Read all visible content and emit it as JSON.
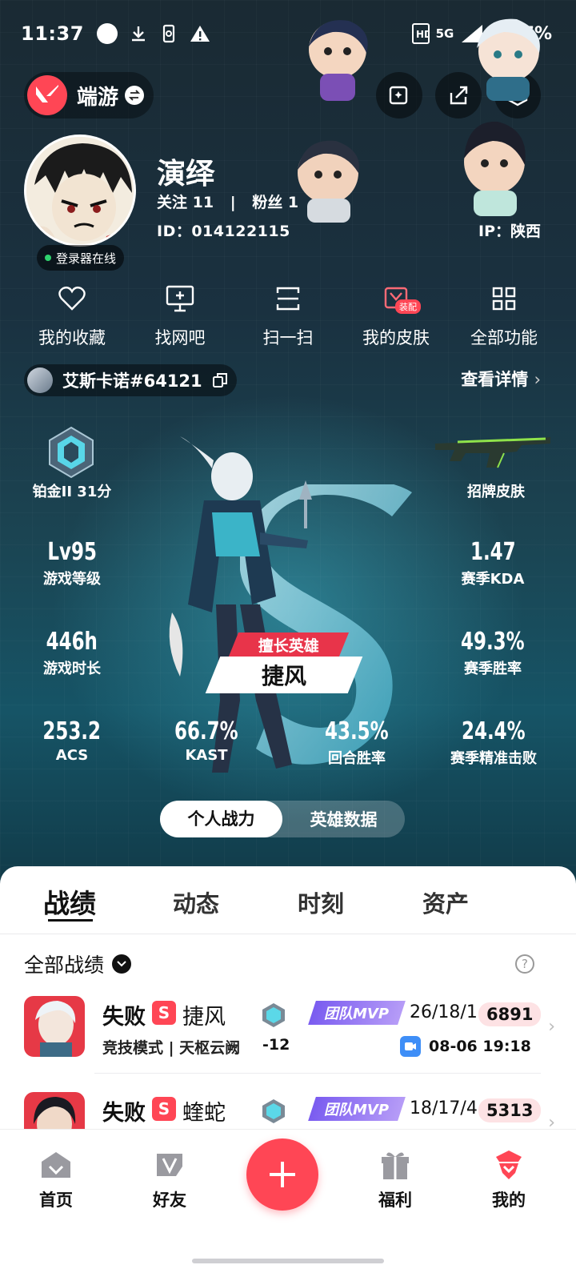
{
  "status": {
    "time": "11:37",
    "network": "5G",
    "battery": "47%"
  },
  "header": {
    "app_name": "端游"
  },
  "profile": {
    "nickname": "演绎",
    "follow_label": "关注 11",
    "fans_label": "粉丝 1",
    "divider": "|",
    "id_label": "ID：014122115",
    "ip_label": "IP：陕西",
    "online": "登录器在线"
  },
  "actions": [
    {
      "label": "我的收藏",
      "icon": "heart-icon"
    },
    {
      "label": "找网吧",
      "icon": "monitor-icon"
    },
    {
      "label": "扫一扫",
      "icon": "scan-icon"
    },
    {
      "label": "我的皮肤",
      "icon": "skin-icon",
      "tag": "装配"
    },
    {
      "label": "全部功能",
      "icon": "grid-icon"
    }
  ],
  "riot": {
    "name": "艾斯卡诺#64121",
    "detail": "查看详情"
  },
  "rank": {
    "label": "铂金II 31分"
  },
  "skin": {
    "label": "招牌皮肤"
  },
  "stats": {
    "level": {
      "v": "Lv95",
      "k": "游戏等级"
    },
    "kda": {
      "v": "1.47",
      "k": "赛季KDA"
    },
    "hours": {
      "v": "446h",
      "k": "游戏时长"
    },
    "winrate": {
      "v": "49.3%",
      "k": "赛季胜率"
    },
    "acs": {
      "v": "253.2",
      "k": "ACS"
    },
    "kast": {
      "v": "66.7%",
      "k": "KAST"
    },
    "round": {
      "v": "43.5%",
      "k": "回合胜率"
    },
    "precise": {
      "v": "24.4%",
      "k": "赛季精准击败"
    }
  },
  "best_agent": {
    "title": "擅长英雄",
    "name": "捷风"
  },
  "toggle": {
    "left": "个人战力",
    "right": "英雄数据"
  },
  "tabs": [
    "战绩",
    "动态",
    "时刻",
    "资产"
  ],
  "filter": {
    "label": "全部战绩",
    "help": "?"
  },
  "matches": [
    {
      "result": "失败",
      "s": "S",
      "agent": "捷风",
      "mode": "竞技模式 | 天枢云阙",
      "delta": "-12",
      "mvp": "团队MVP",
      "kda": "26/18/1",
      "score": "6891",
      "time": "08-06 19:18"
    },
    {
      "result": "失败",
      "s": "S",
      "agent": "蝰蛇",
      "mvp": "团队MVP",
      "kda": "18/17/4",
      "score": "5313"
    }
  ],
  "nav": [
    {
      "label": "首页",
      "icon": "home-icon"
    },
    {
      "label": "好友",
      "icon": "friends-icon"
    },
    {
      "label": "福利",
      "icon": "gift-icon"
    },
    {
      "label": "我的",
      "icon": "profile-icon"
    }
  ],
  "colors": {
    "accent": "#ff4655",
    "mvp": "#8a6cf2"
  }
}
